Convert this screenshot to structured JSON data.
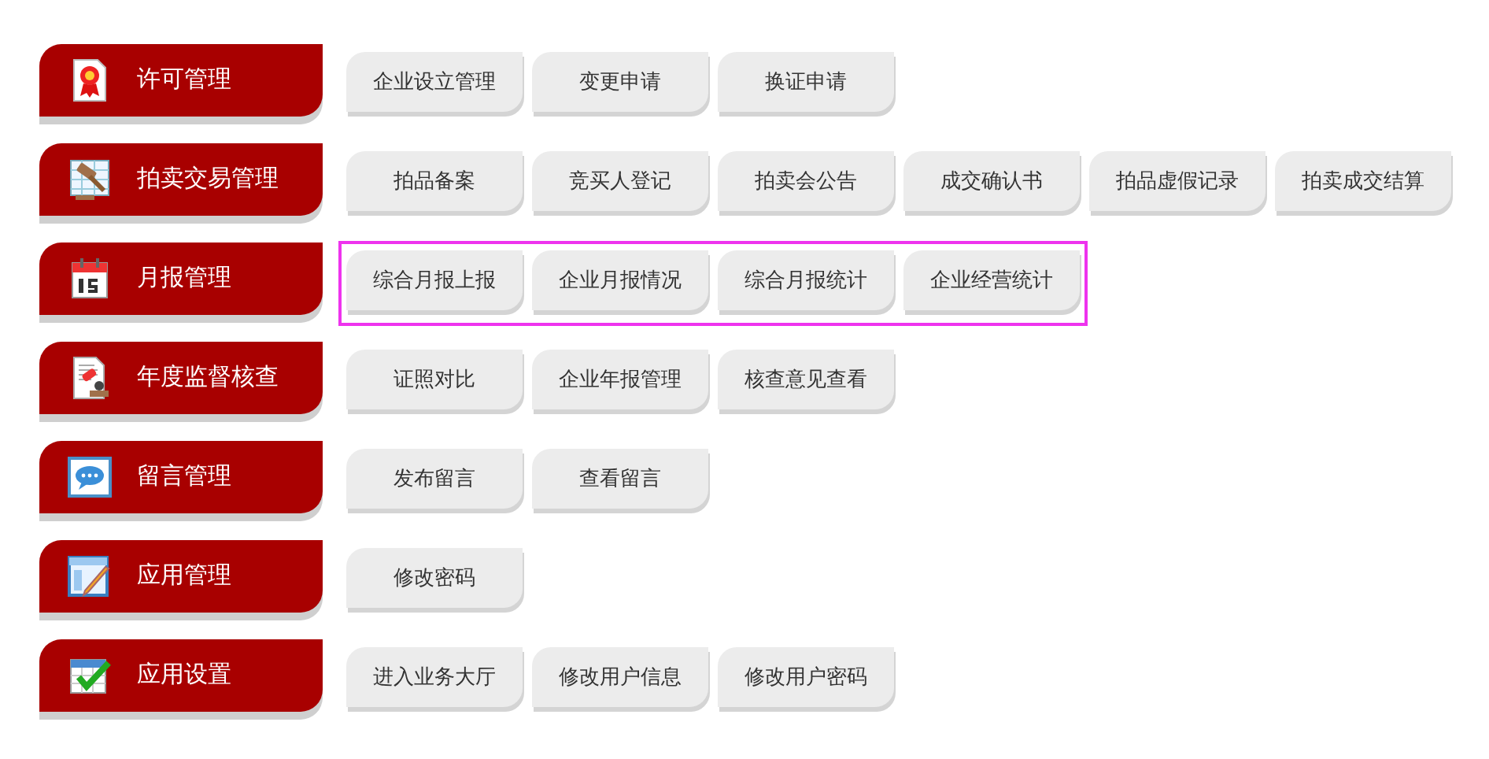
{
  "categories": [
    {
      "label": "许可管理",
      "highlighted": false,
      "items": [
        "企业设立管理",
        "变更申请",
        "换证申请"
      ]
    },
    {
      "label": "拍卖交易管理",
      "highlighted": false,
      "items": [
        "拍品备案",
        "竞买人登记",
        "拍卖会公告",
        "成交确认书",
        "拍品虚假记录",
        "拍卖成交结算"
      ]
    },
    {
      "label": "月报管理",
      "highlighted": true,
      "items": [
        "综合月报上报",
        "企业月报情况",
        "综合月报统计",
        "企业经营统计"
      ]
    },
    {
      "label": "年度监督核查",
      "highlighted": false,
      "items": [
        "证照对比",
        "企业年报管理",
        "核查意见查看"
      ]
    },
    {
      "label": "留言管理",
      "highlighted": false,
      "items": [
        "发布留言",
        "查看留言"
      ]
    },
    {
      "label": "应用管理",
      "highlighted": false,
      "items": [
        "修改密码"
      ]
    },
    {
      "label": "应用设置",
      "highlighted": false,
      "items": [
        "进入业务大厅",
        "修改用户信息",
        "修改用户密码"
      ]
    }
  ]
}
